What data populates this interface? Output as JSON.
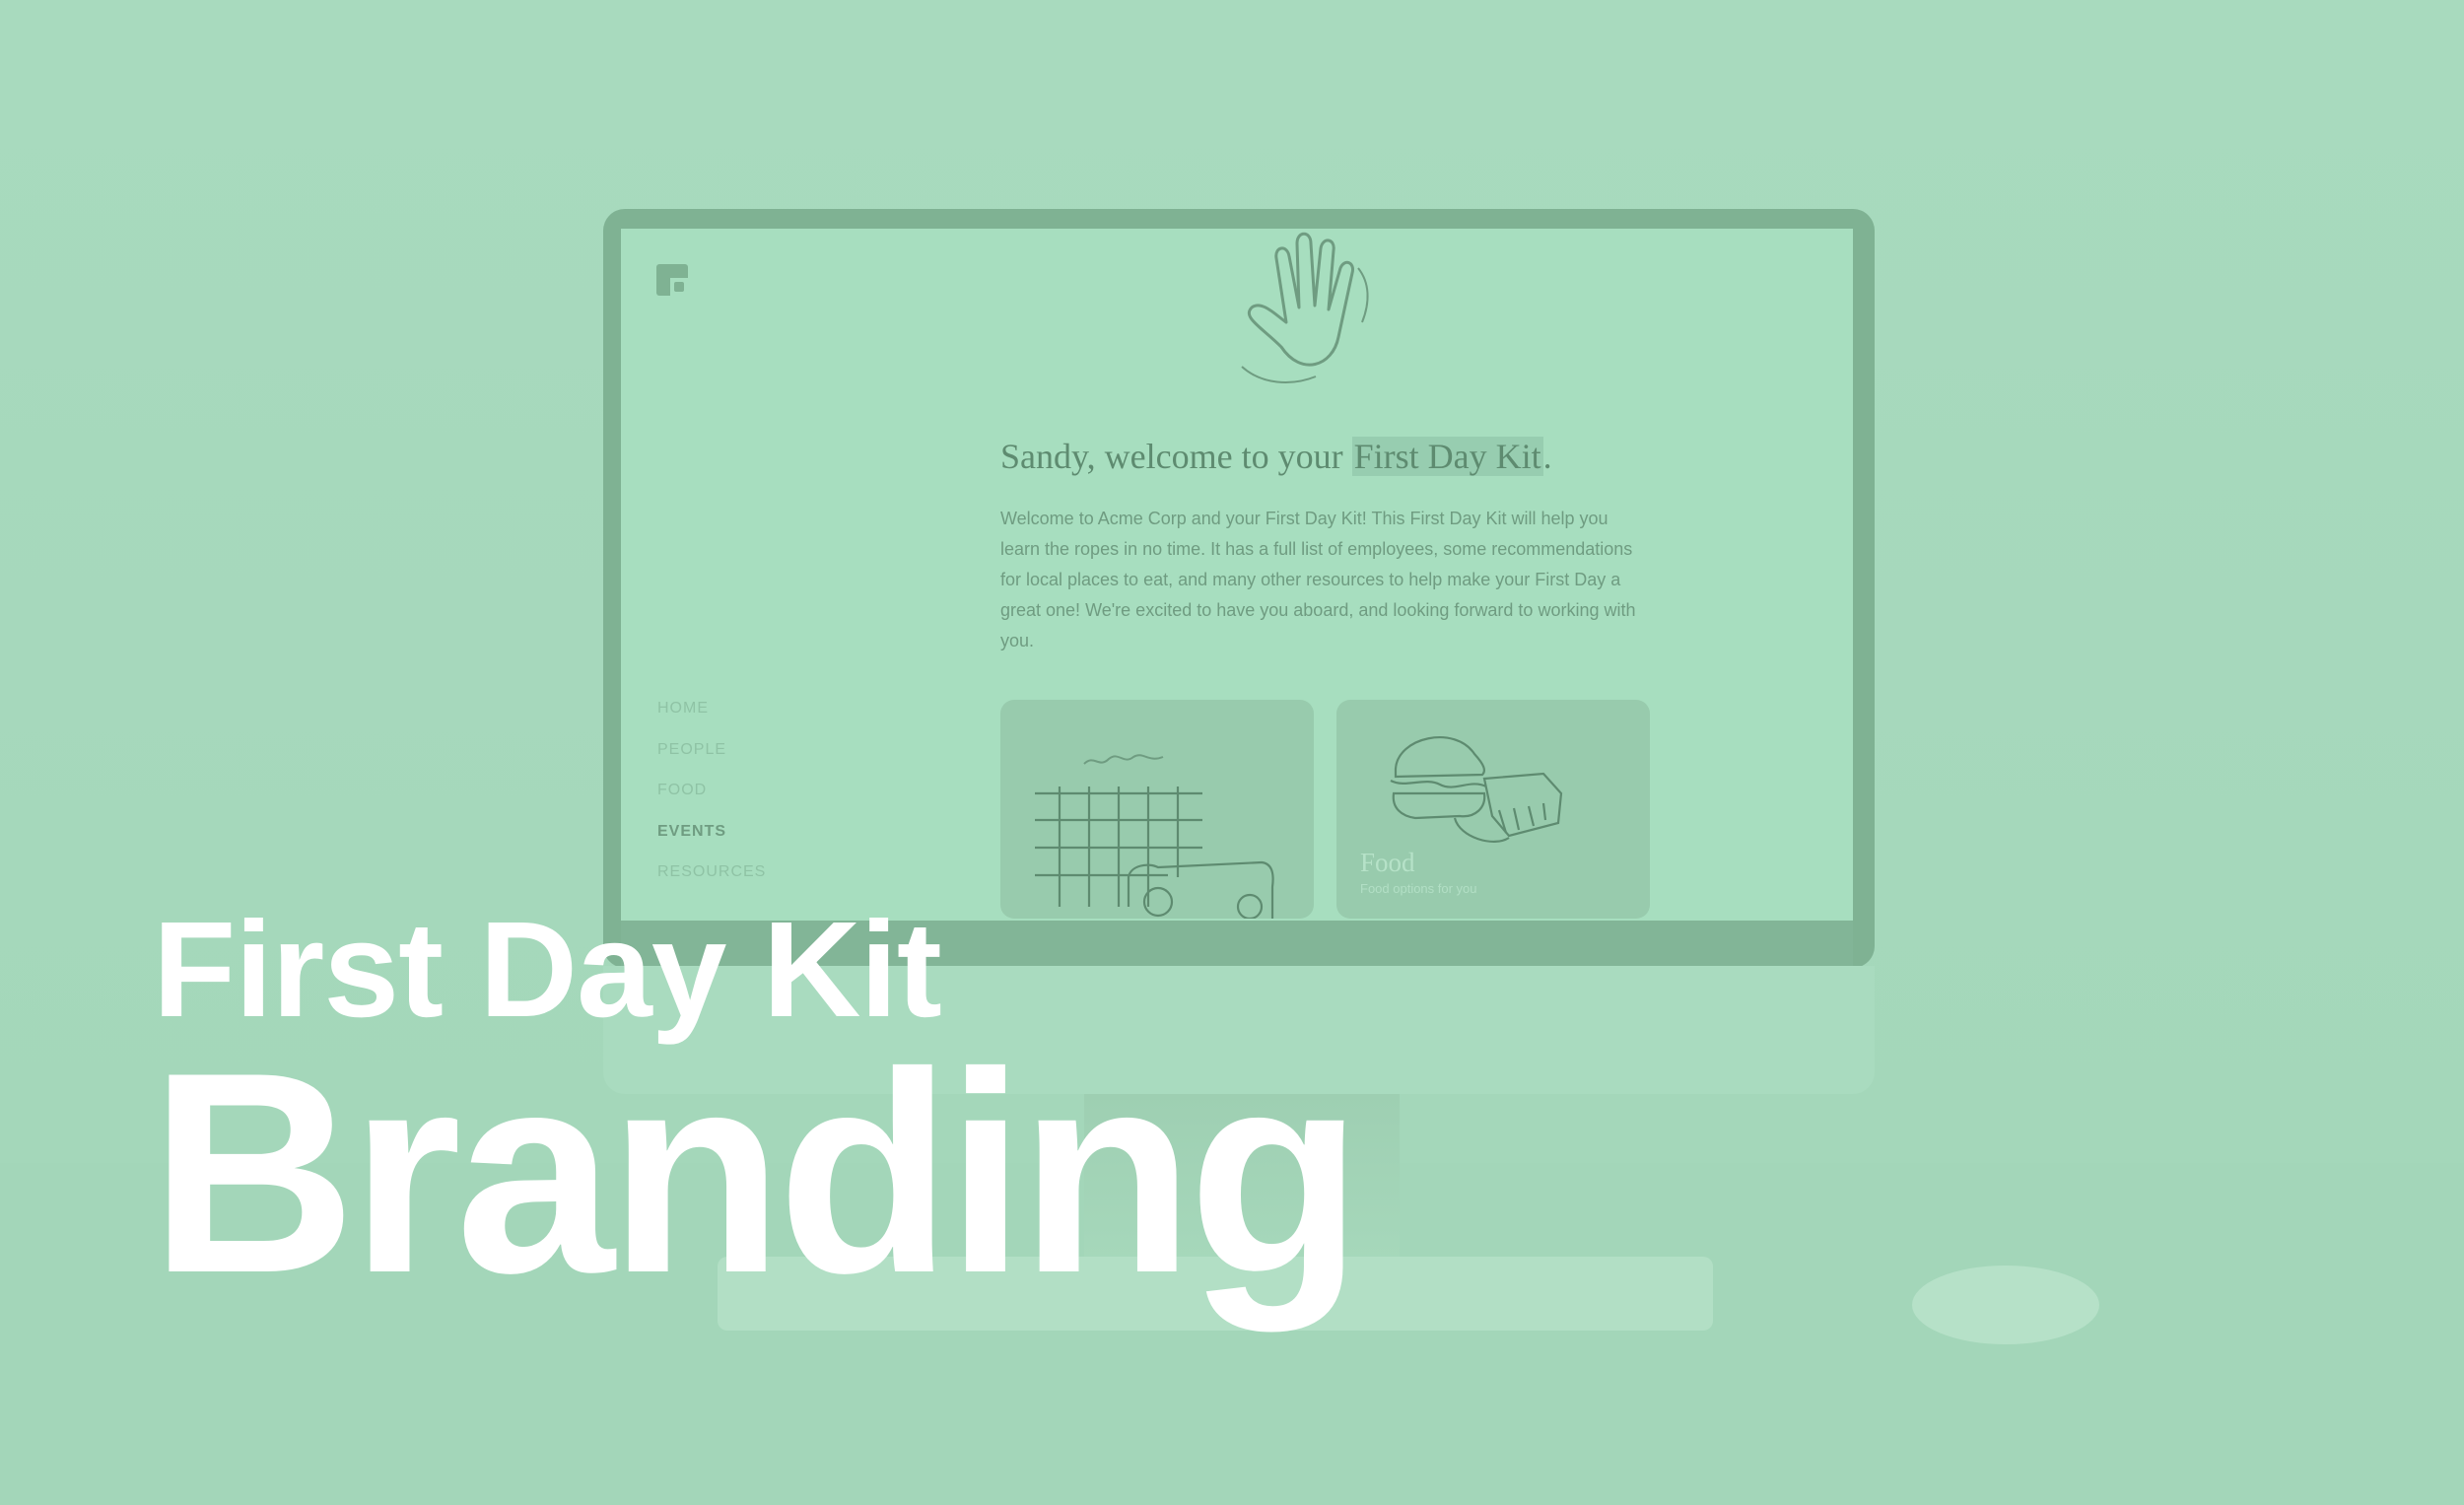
{
  "hero": {
    "kicker": "First Day Kit",
    "title": "Branding"
  },
  "screen": {
    "welcome_prefix": "Sandy, welcome to your ",
    "welcome_highlight": "First Day Kit",
    "welcome_suffix": ".",
    "intro": "Welcome to Acme Corp and your First Day Kit! This First Day Kit will help you learn the ropes in no time. It has a full list of employees, some recommendations for local places to eat, and many other resources to help make your First Day a great one! We're excited to have you aboard, and looking forward to working with you.",
    "nav": [
      "HOME",
      "PEOPLE",
      "FOOD",
      "EVENTS",
      "RESOURCES"
    ],
    "nav_active": "EVENTS",
    "cards": [
      {
        "title": "",
        "subtitle": ""
      },
      {
        "title": "Food",
        "subtitle": "Food options for you"
      }
    ]
  },
  "colors": {
    "overlay": "#a6d9bc",
    "text_white": "#ffffff",
    "bezel": "#7fb293"
  }
}
